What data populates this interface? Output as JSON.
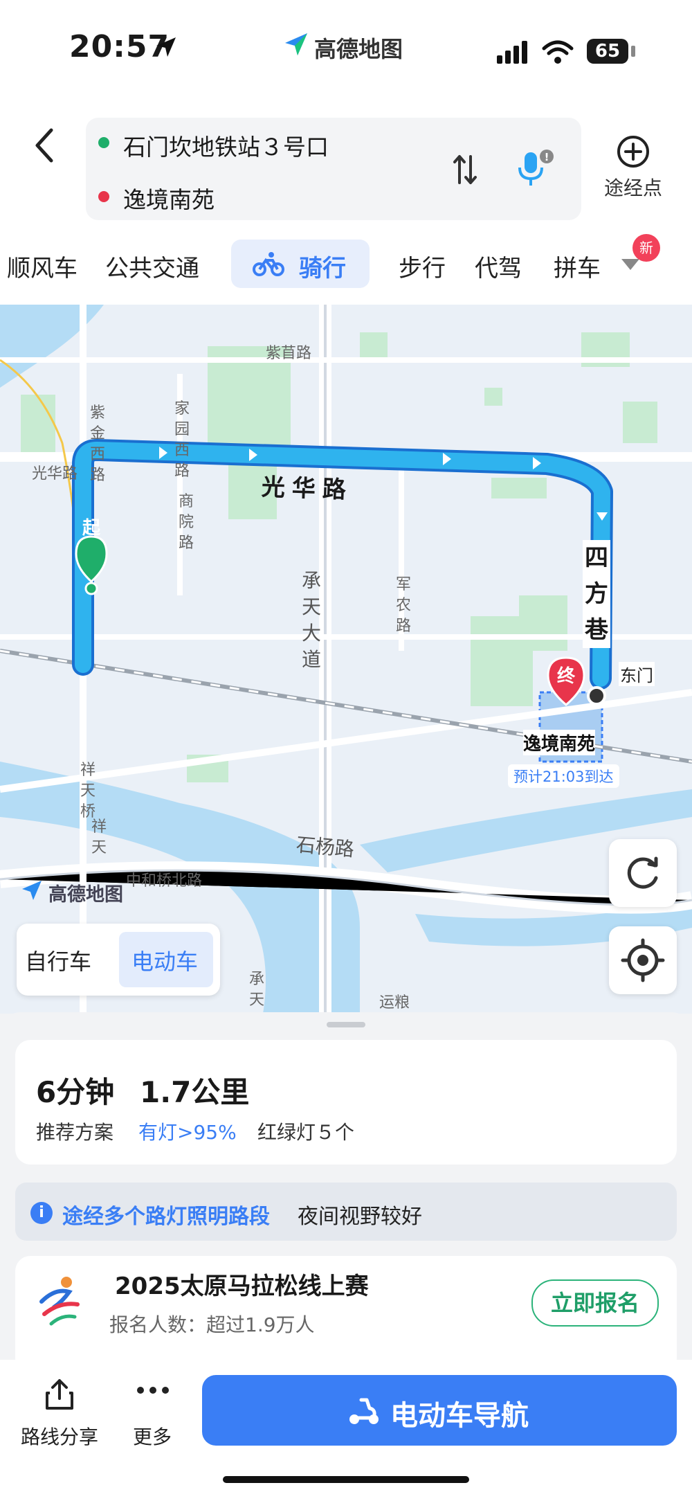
{
  "status_bar": {
    "time": "20:57",
    "app_name": "高德地图",
    "battery": "65"
  },
  "route": {
    "origin": "石门坎地铁站３号口",
    "destination": "逸境南苑",
    "waypoint_label": "途经点"
  },
  "tabs": [
    "顺风车",
    "公共交通",
    "骑行",
    "步行",
    "代驾",
    "拼车"
  ],
  "active_tab": "骑行",
  "tabs_badge": "新",
  "map": {
    "road_labels": [
      "紫苜路",
      "家园西路",
      "紫金西路",
      "光华路",
      "商院路",
      "承天大道",
      "军农路",
      "石杨路",
      "中和桥北路",
      "祥天桥",
      "祥天",
      "承天",
      "运粮"
    ],
    "route_road_label": "光华路",
    "route_road_label_2": "四方巷",
    "start_marker": "起",
    "end_marker": "终",
    "destination_name": "逸境南苑",
    "eta": "预计21:03到达",
    "gate_label": "东门",
    "watermark": "高德地图"
  },
  "vehicle_toggle": {
    "bike": "自行车",
    "ebike": "电动车",
    "active": "电动车"
  },
  "summary": {
    "duration": "6分钟",
    "distance": "1.7公里",
    "plan_label": "推荐方案",
    "light_info": "有灯>95%",
    "traffic_lights": "红绿灯５个"
  },
  "notice": {
    "highlight": "途经多个路灯照明路段",
    "text": "夜间视野较好"
  },
  "promo": {
    "title": "2025太原马拉松线上赛",
    "subtitle": "报名人数：超过1.9万人",
    "button": "立即报名"
  },
  "bottom_bar": {
    "share": "路线分享",
    "more": "更多",
    "navigate": "电动车导航"
  },
  "colors": {
    "accent": "#3a7ef5",
    "route": "#29a7e8",
    "start": "#1fae6a",
    "end": "#e8354b"
  }
}
